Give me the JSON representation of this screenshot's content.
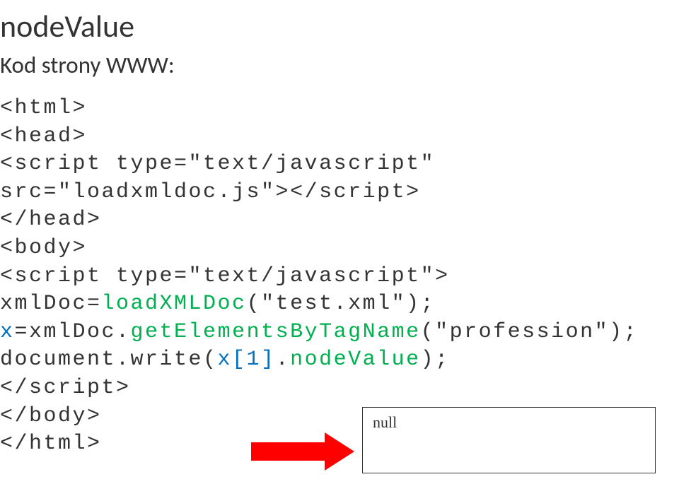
{
  "title": "nodeValue",
  "subtitle": "Kod strony WWW:",
  "code": {
    "line1": "<html>",
    "line2": "<head>",
    "line3_a": "<script type=\"text/javascript\"",
    "line4_a": "src=\"loadxmldoc.js\">",
    "line4_b": "</script>",
    "line5": "</head>",
    "line6": "<body>",
    "line7": "<script type=\"text/javascript\">",
    "line8_a": "xmlDoc=",
    "line8_b": "loadXMLDoc",
    "line8_c": "(\"test.xml\");",
    "line9_a": "x",
    "line9_b": "=xmlDoc.",
    "line9_c": "getElementsByTagName",
    "line9_d": "(\"profession\");",
    "line10_a": "document.write(",
    "line10_b": "x[1]",
    "line10_c": ".",
    "line10_d": "nodeValue",
    "line10_e": ");",
    "line11": "</script>",
    "line12": "</body>",
    "line13": "</html>"
  },
  "output": "null"
}
